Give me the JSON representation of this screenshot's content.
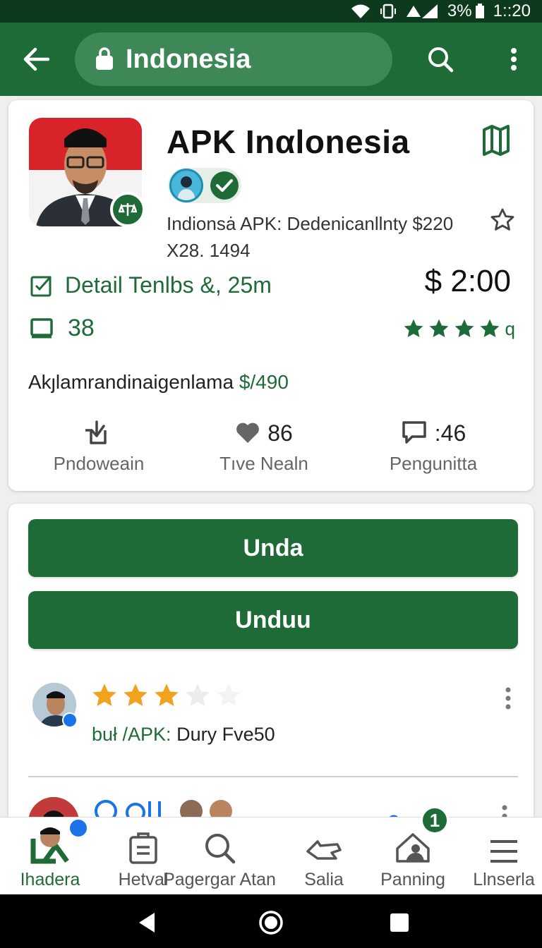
{
  "status_bar": {
    "battery": "3%",
    "time": "1::20"
  },
  "app_bar": {
    "search_text": "Indonesia"
  },
  "app": {
    "title": "APK Inαlonesia",
    "description": "Indionsȧ APK: Dedenicanllnty $220 X28. 1494",
    "detail": "Detail Tenlbs &, 25m",
    "price": "$ 2:00",
    "count": "38",
    "rating_suffix": "q",
    "rating_stars": 4,
    "meta_label": "Akȷlamrandinaigenlama",
    "meta_value": "$/490"
  },
  "stats": [
    {
      "value": "",
      "label": "Pndoweain",
      "icon": "download-icon"
    },
    {
      "value": "86",
      "label": "Tıve Nealn",
      "icon": "heart-icon"
    },
    {
      "value": ":46",
      "label": "Pengunitta",
      "icon": "comment-icon"
    }
  ],
  "actions": {
    "primary_label": "Unda",
    "secondary_label": "Unduu"
  },
  "review": {
    "stars": 3,
    "text_accent": "buł /APK:",
    "text_rest": " Dury Fve50"
  },
  "bottom_nav": {
    "items": [
      {
        "label": "Ihadera",
        "icon": "home-logo-icon"
      },
      {
        "label": "Hetval",
        "icon": "clipboard-icon"
      },
      {
        "label": "Pagergar Atan",
        "icon": "search-icon"
      },
      {
        "label": "Salia",
        "icon": "hand-icon"
      },
      {
        "label": "Panning",
        "icon": "home-icon"
      },
      {
        "label": "Llnserla",
        "icon": "menu-icon"
      }
    ],
    "badge": "1"
  },
  "colors": {
    "primary": "#1e6b38",
    "appbar": "#1e6b38",
    "statusbar": "#0d3a1d",
    "star_gold": "#f1a31f"
  }
}
